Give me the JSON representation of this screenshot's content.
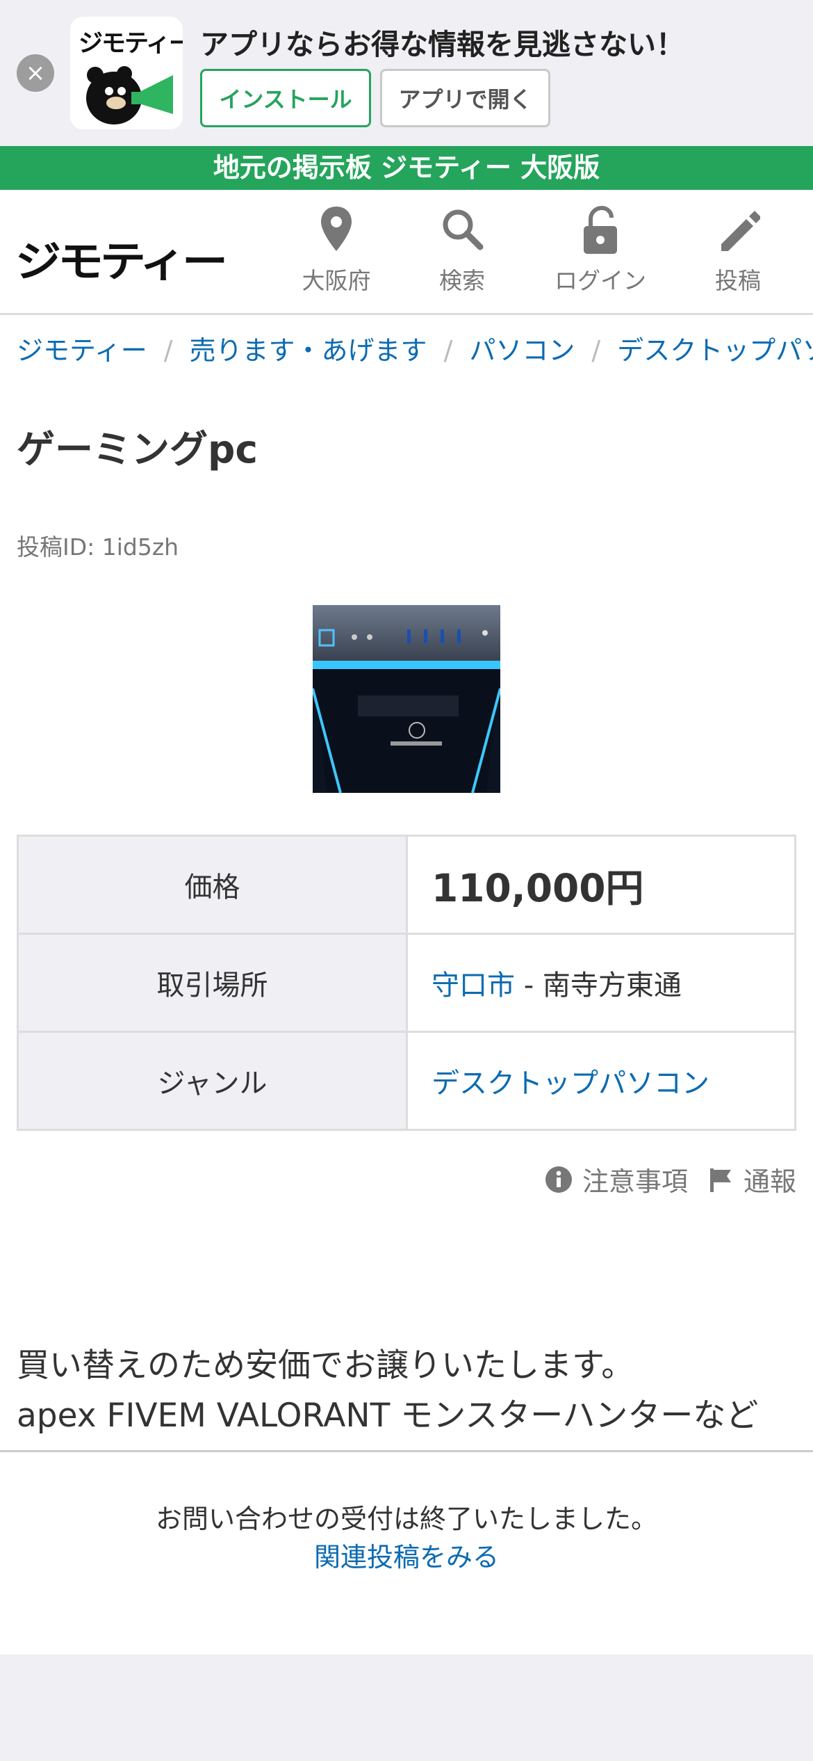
{
  "app_banner": {
    "close_icon": "close-icon",
    "app_name": "ジモティー",
    "message": "アプリならお得な情報を見逃さない！",
    "install_label": "インストール",
    "open_label": "アプリで開く"
  },
  "strip": {
    "text": "地元の掲示板 ジモティー 大阪版"
  },
  "header": {
    "logo": "ジモティー",
    "nav": [
      {
        "label": "大阪府",
        "icon": "location-pin-icon"
      },
      {
        "label": "検索",
        "icon": "search-icon"
      },
      {
        "label": "ログイン",
        "icon": "lock-icon"
      },
      {
        "label": "投稿",
        "icon": "pencil-icon"
      }
    ]
  },
  "breadcrumb": [
    "ジモティー",
    "売ります・あげます",
    "パソコン",
    "デスクトップパソコン"
  ],
  "post": {
    "title": "ゲーミングpc",
    "post_id": "投稿ID: 1id5zh",
    "table": {
      "price_label": "価格",
      "price_value": "110,000円",
      "place_label": "取引場所",
      "place_city": "守口市",
      "place_area": " - 南寺方東通",
      "genre_label": "ジャンル",
      "genre_value": "デスクトップパソコン"
    },
    "notice_label": "注意事項",
    "report_label": "通報",
    "description": [
      "買い替えのため安価でお譲りいたします。",
      "apex FIVEM VALORANT モンスターハンターなど"
    ]
  },
  "footer": {
    "closed_message": "お問い合わせの受付は終了いたしました。",
    "related_link": "関連投稿をみる"
  }
}
